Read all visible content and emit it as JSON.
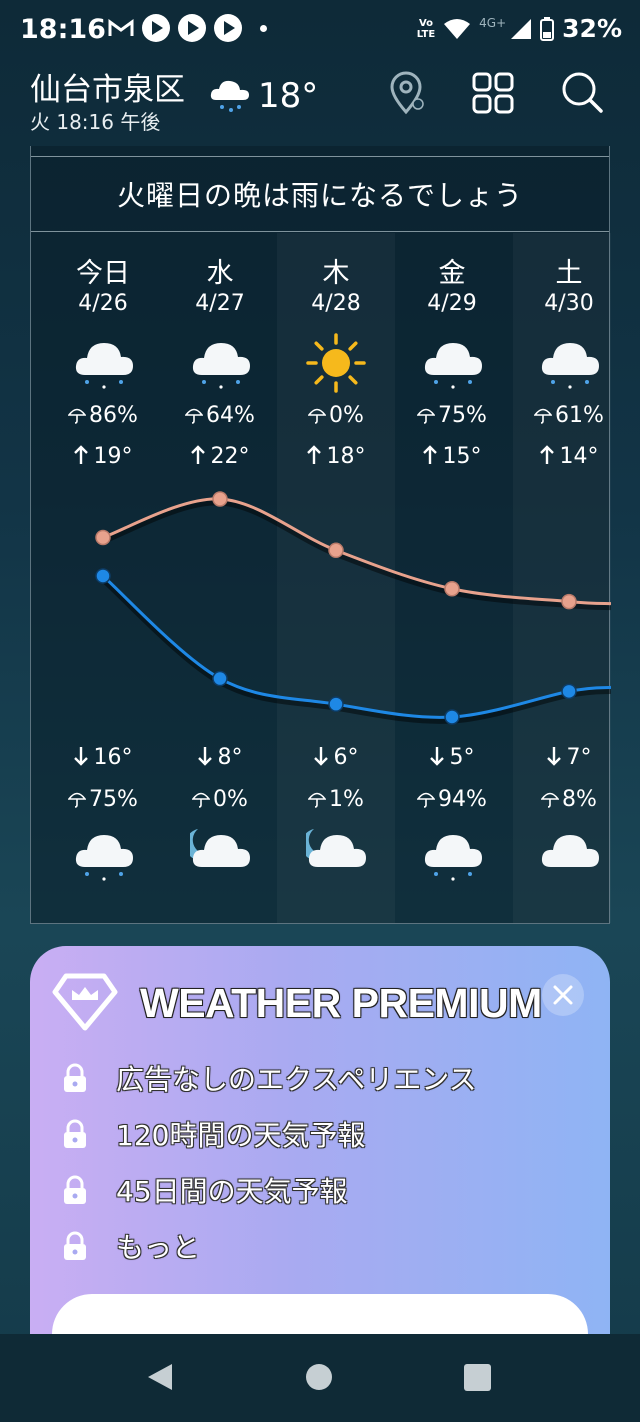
{
  "status_bar": {
    "time": "18:16",
    "volte_line1": "Vo",
    "volte_line2": "LTE",
    "network": "4G+",
    "battery": "32%"
  },
  "header": {
    "location": "仙台市泉区",
    "datetime": "火 18:16 午後",
    "current_temp": "18°",
    "current_icon": "cloud-rain-icon"
  },
  "forecast": {
    "headline": "火曜日の晩は雨になるでしょう",
    "days": [
      {
        "name": "今日",
        "date": "4/26",
        "day_icon": "cloud-rain-icon",
        "rain_day": "86%",
        "high": "19°",
        "low": "16°",
        "rain_night": "75%",
        "night_icon": "cloud-rain-icon"
      },
      {
        "name": "水",
        "date": "4/27",
        "day_icon": "cloud-rain-icon",
        "rain_day": "64%",
        "high": "22°",
        "low": "8°",
        "rain_night": "0%",
        "night_icon": "moon-cloud-icon"
      },
      {
        "name": "木",
        "date": "4/28",
        "day_icon": "sun-icon",
        "rain_day": "0%",
        "high": "18°",
        "low": "6°",
        "rain_night": "1%",
        "night_icon": "moon-cloud-icon"
      },
      {
        "name": "金",
        "date": "4/29",
        "day_icon": "cloud-rain-icon",
        "rain_day": "75%",
        "high": "15°",
        "low": "5°",
        "rain_night": "94%",
        "night_icon": "cloud-rain-icon"
      },
      {
        "name": "土",
        "date": "4/30",
        "day_icon": "cloud-rain-icon",
        "rain_day": "61%",
        "high": "14°",
        "low": "7°",
        "rain_night": "8%",
        "night_icon": "cloud-icon"
      }
    ]
  },
  "chart_data": {
    "type": "line",
    "categories": [
      "4/26",
      "4/27",
      "4/28",
      "4/29",
      "4/30"
    ],
    "series": [
      {
        "values": [
          19,
          22,
          18,
          15,
          14
        ],
        "color": "#e8a28d"
      },
      {
        "values": [
          16,
          8,
          6,
          5,
          7
        ],
        "color": "#1e88e5"
      }
    ]
  },
  "premium": {
    "title": "WEATHER PREMIUM",
    "features": [
      "広告なしのエクスペリエンス",
      "120時間の天気予報",
      "45日間の天気予報",
      "もっと"
    ]
  },
  "colors": {
    "high_line": "#e8a28d",
    "low_line": "#1e88e5",
    "sun": "#f6b91c"
  }
}
